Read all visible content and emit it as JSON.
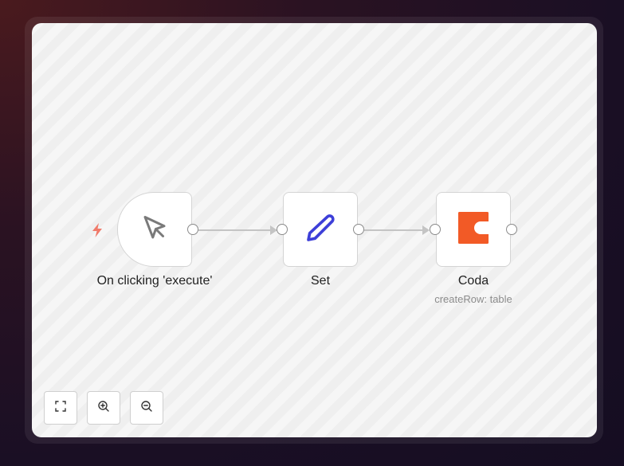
{
  "canvas": {
    "nodes": [
      {
        "id": "trigger",
        "label": "On clicking 'execute'",
        "subtitle": "",
        "icon": "cursor-icon"
      },
      {
        "id": "set",
        "label": "Set",
        "subtitle": "",
        "icon": "pen-icon"
      },
      {
        "id": "coda",
        "label": "Coda",
        "subtitle": "createRow: table",
        "icon": "coda-logo-icon"
      }
    ]
  },
  "controls": {
    "fit_view": "fit-to-view-icon",
    "zoom_in": "zoom-in-icon",
    "zoom_out": "zoom-out-icon"
  },
  "colors": {
    "trigger_bolt": "#f07a6a",
    "set_icon": "#3d3fd8",
    "coda_brand": "#f25a26",
    "node_border": "#d4d4d4",
    "edge": "#c4c4c4"
  }
}
